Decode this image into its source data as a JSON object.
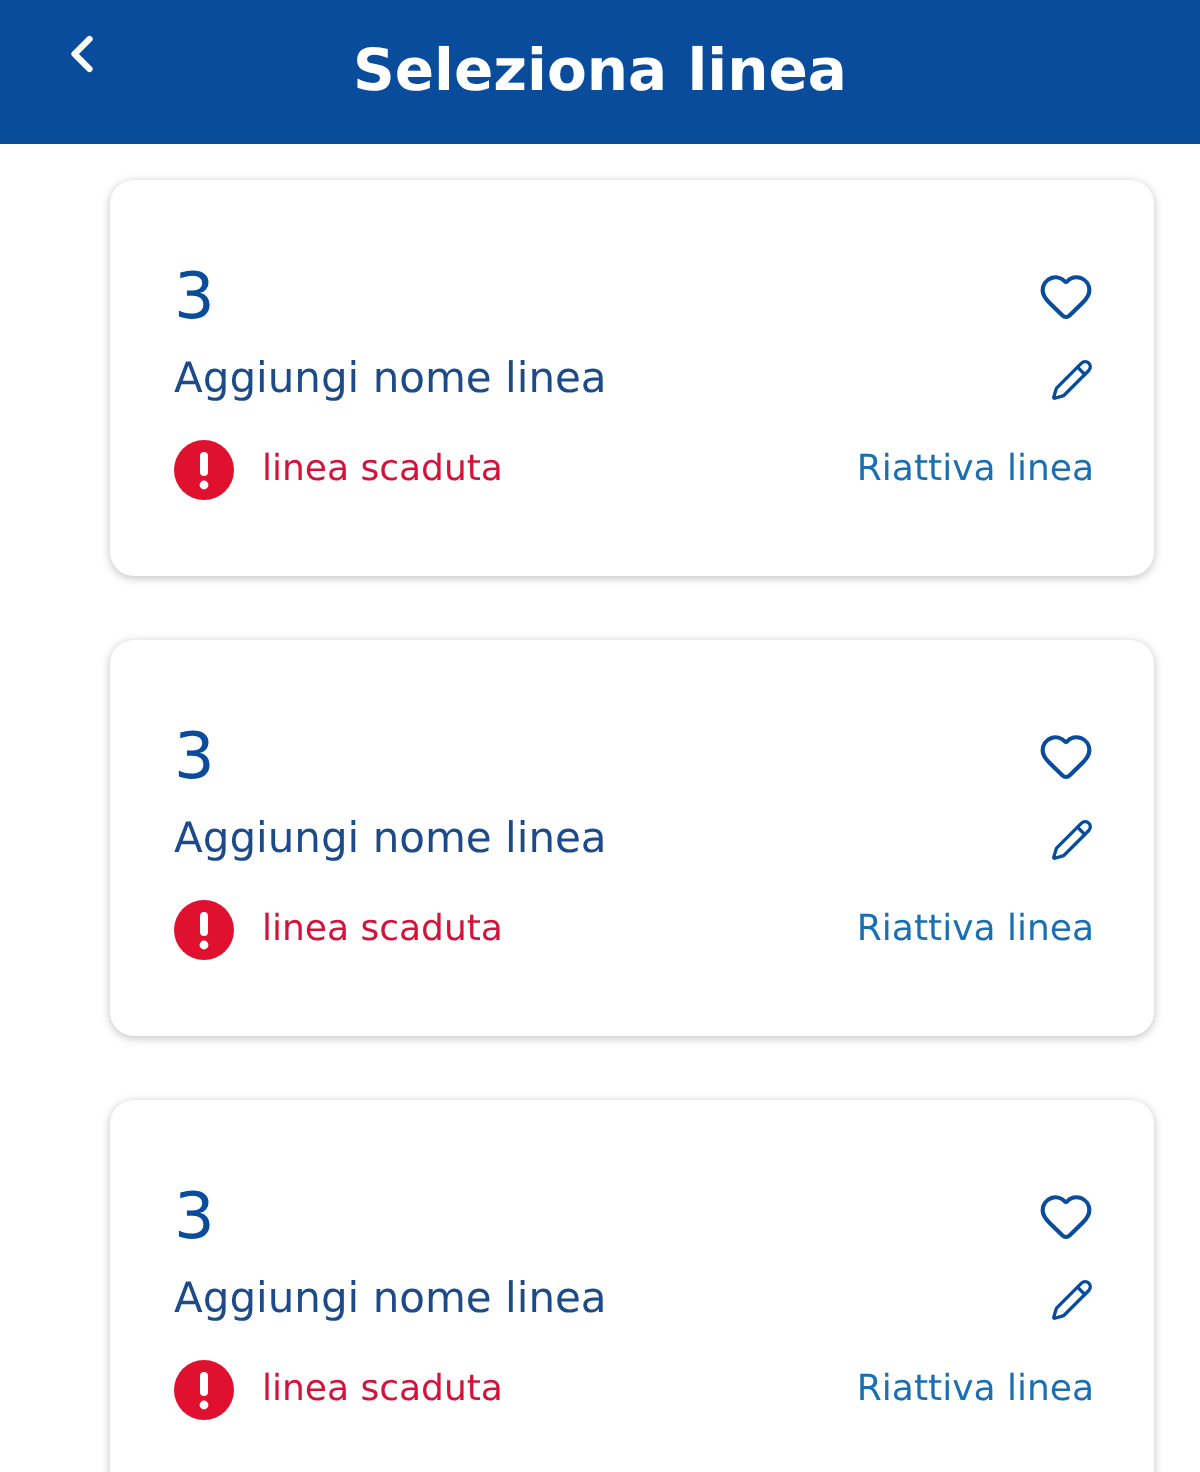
{
  "header": {
    "title": "Seleziona linea"
  },
  "lines": [
    {
      "number": "3",
      "name": "Aggiungi nome linea",
      "status": "linea scaduta",
      "action": "Riattiva linea",
      "favorite": false
    },
    {
      "number": "3",
      "name": "Aggiungi nome linea",
      "status": "linea scaduta",
      "action": "Riattiva linea",
      "favorite": false
    },
    {
      "number": "3",
      "name": "Aggiungi nome linea",
      "status": "linea scaduta",
      "action": "Riattiva linea",
      "favorite": false
    }
  ]
}
